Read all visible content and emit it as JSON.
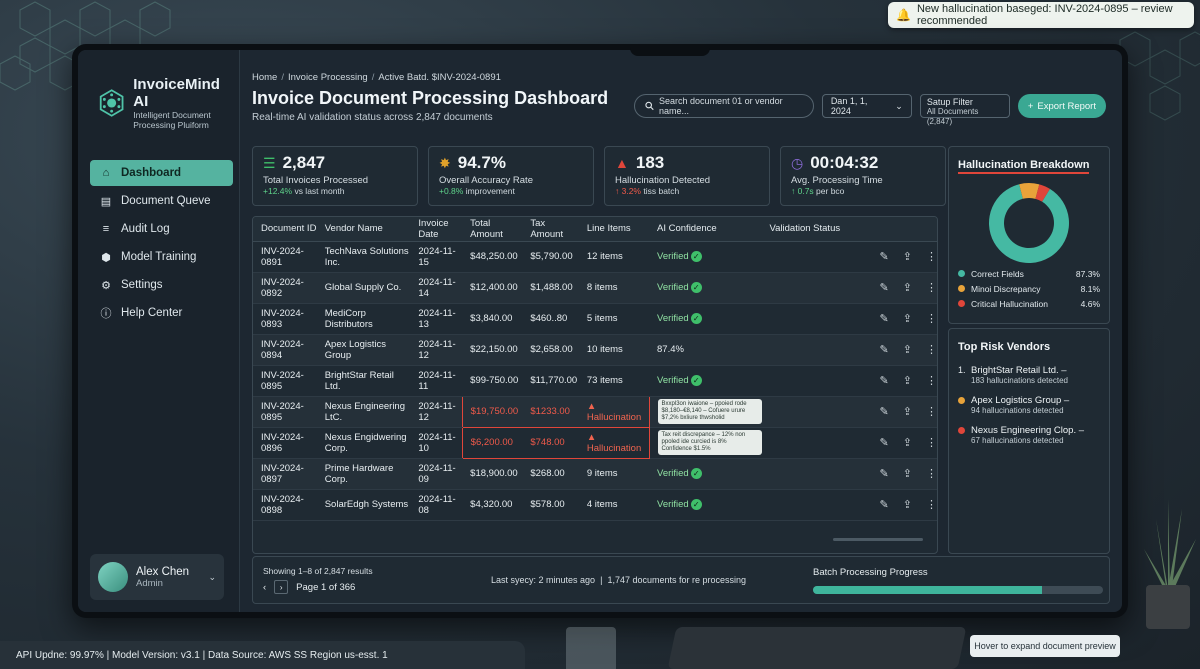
{
  "notification": {
    "text": "New hallucination baseged: INV-2024-0895 – review recommended"
  },
  "brand": {
    "name": "InvoiceMind AI",
    "sub1": "Intelligent Document",
    "sub2": "Processing Pluiform"
  },
  "nav": [
    {
      "label": "Dashboard",
      "icon": "home-icon",
      "active": true
    },
    {
      "label": "Document Queve",
      "icon": "folder-icon",
      "active": false
    },
    {
      "label": "Audit Log",
      "icon": "log-icon",
      "active": false
    },
    {
      "label": "Model Training",
      "icon": "cube-icon",
      "active": false
    },
    {
      "label": "Settings",
      "icon": "gear-icon",
      "active": false
    },
    {
      "label": "Help Center",
      "icon": "help-icon",
      "active": false
    }
  ],
  "user": {
    "name": "Alex Chen",
    "role": "Admin"
  },
  "breadcrumb": {
    "a": "Home",
    "b": "Invoice Processing",
    "c": "Active Batd. $INV-2024-0891"
  },
  "header": {
    "title": "Invoice Document Processing Dashboard",
    "subtitle": "Real-time AI validation status across 2,847 documents"
  },
  "controls": {
    "search_placeholder": "Search document 01 or vendor name...",
    "date": "Dan 1, 1, 2024",
    "filter_label": "Satup Filter",
    "filter_value": "All Documents (2,847)",
    "export": "Export Report"
  },
  "stats": [
    {
      "value": "2,847",
      "label": "Total Invoices Processed",
      "delta": "+12.4%",
      "delta_rest": " vs last month",
      "color": "#3fbf6a",
      "icon": "doc-icon",
      "neg": false
    },
    {
      "value": "94.7%",
      "label": "Overall Accuracy Rate",
      "delta": "+0.8%",
      "delta_rest": " improvement",
      "color": "#e0a12a",
      "icon": "brain-icon",
      "neg": false
    },
    {
      "value": "183",
      "label": "Hallucination Detected",
      "delta": "↑ 3.2%",
      "delta_rest": " tiss batch",
      "color": "#e0463a",
      "icon": "warning-icon",
      "neg": true
    },
    {
      "value": "00:04:32",
      "label": "Avg. Processing Time",
      "delta": "↑ 0.7s",
      "delta_rest": " per bco",
      "color": "#8b6cd8",
      "icon": "clock-icon",
      "neg": false
    }
  ],
  "table": {
    "headers": [
      "Document ID",
      "Vendor Name",
      "Invoice Date",
      "Total Amount",
      "Tax Amount",
      "Line Items",
      "AI Confidence",
      "Validation Status"
    ],
    "rows": [
      {
        "id": "INV-2024-0891",
        "vendor": "TechNava Solutions Inc.",
        "date": "2024-11-15",
        "total": "$48,250.00",
        "tax": "$5,790.00",
        "items": "12 items",
        "conf": "Verified",
        "type": "ok"
      },
      {
        "id": "INV-2024-0892",
        "vendor": "Global Supply Co.",
        "date": "2024-11-14",
        "total": "$12,400.00",
        "tax": "$1,488.00",
        "items": "8 items",
        "conf": "Verified",
        "type": "ok"
      },
      {
        "id": "INV-2024-0893",
        "vendor": "MediCorp Distributors",
        "date": "2024-11-13",
        "total": "$3,840.00",
        "tax": "$460..80",
        "items": "5 items",
        "conf": "Verified",
        "type": "ok"
      },
      {
        "id": "INV-2024-0894",
        "vendor": "Apex Logistics Group",
        "date": "2024-11-12",
        "total": "$22,150.00",
        "tax": "$2,658.00",
        "items": "10 items",
        "conf": "87.4%",
        "type": "plain"
      },
      {
        "id": "INV-2024-0895",
        "vendor": "BrightStar Retail Ltd.",
        "date": "2024-11-11",
        "total": "$99-750.00",
        "tax": "$11,770.00",
        "items": "73 items",
        "conf": "Verified",
        "type": "ok"
      },
      {
        "id": "INV-2024-0895",
        "vendor": "Nexus Engineering LtC.",
        "date": "2024-11-12",
        "total": "$19,750.00",
        "tax": "$1233.00",
        "items": "Hallucination",
        "conf": "Bxxpl3on iwaione – ppoied rode $8,180–€8,140 – Cofuere urure $7,2% bxliure thwsholid",
        "type": "hal"
      },
      {
        "id": "INV-2024-0896",
        "vendor": "Nexus Engidwering Corp.",
        "date": "2024-11-10",
        "total": "$6,200.00",
        "tax": "$748.00",
        "items": "Hallucination",
        "conf": "Tax reit discrepance – 12% non ppoled ide curcied is 8% Confidence $1.5%",
        "type": "hal"
      },
      {
        "id": "INV-2024-0897",
        "vendor": "Prime Hardware Corp.",
        "date": "2024-11-09",
        "total": "$18,900.00",
        "tax": "$268.00",
        "items": "9 items",
        "conf": "Verified",
        "type": "ok"
      },
      {
        "id": "INV-2024-0898",
        "vendor": "SolarEdgh Systems",
        "date": "2024-11-08",
        "total": "$4,320.00",
        "tax": "$578.00",
        "items": "4 items",
        "conf": "Verified",
        "type": "ok"
      }
    ]
  },
  "breakdown": {
    "title": "Hallucination Breakdown",
    "items": [
      {
        "label": "Correct Fields",
        "pct": "87.3%",
        "value": 87.3,
        "color": "#45b9a3"
      },
      {
        "label": "Minoi Discrepancy",
        "pct": "8.1%",
        "value": 8.1,
        "color": "#e8a33a"
      },
      {
        "label": "Critical Hallucination",
        "pct": "4.6%",
        "value": 4.6,
        "color": "#e0463a"
      }
    ]
  },
  "vendors": {
    "title": "Top Risk Vendors",
    "items": [
      {
        "marker": "1.",
        "name": "BrightStar Retail Ltd. –",
        "detail": "183 hallucinations detected",
        "color": ""
      },
      {
        "marker": "",
        "name": "Apex Logistics Group –",
        "detail": "94 hallucinations detected",
        "color": "#e8a33a"
      },
      {
        "marker": "",
        "name": "Nexus Engineering Clop. –",
        "detail": "67 hallucinations detected",
        "color": "#e0463a"
      }
    ]
  },
  "footer": {
    "showing": "Showing 1–8 of 2,847 results",
    "page": "Page 1 of 366",
    "sync": "Last syecy: 2 minutes ago",
    "sep": "|",
    "pending": "1,747 documents for re processing",
    "batch_label": "Batch Processing Progress",
    "batch_progress": 0.79
  },
  "statusbar": {
    "a": "API Updne: 99.97%",
    "b": "Model Version: v3.1",
    "c": "Data Source: AWS SS Region us-esst. 1"
  },
  "hint": "Hover to expand document preview"
}
